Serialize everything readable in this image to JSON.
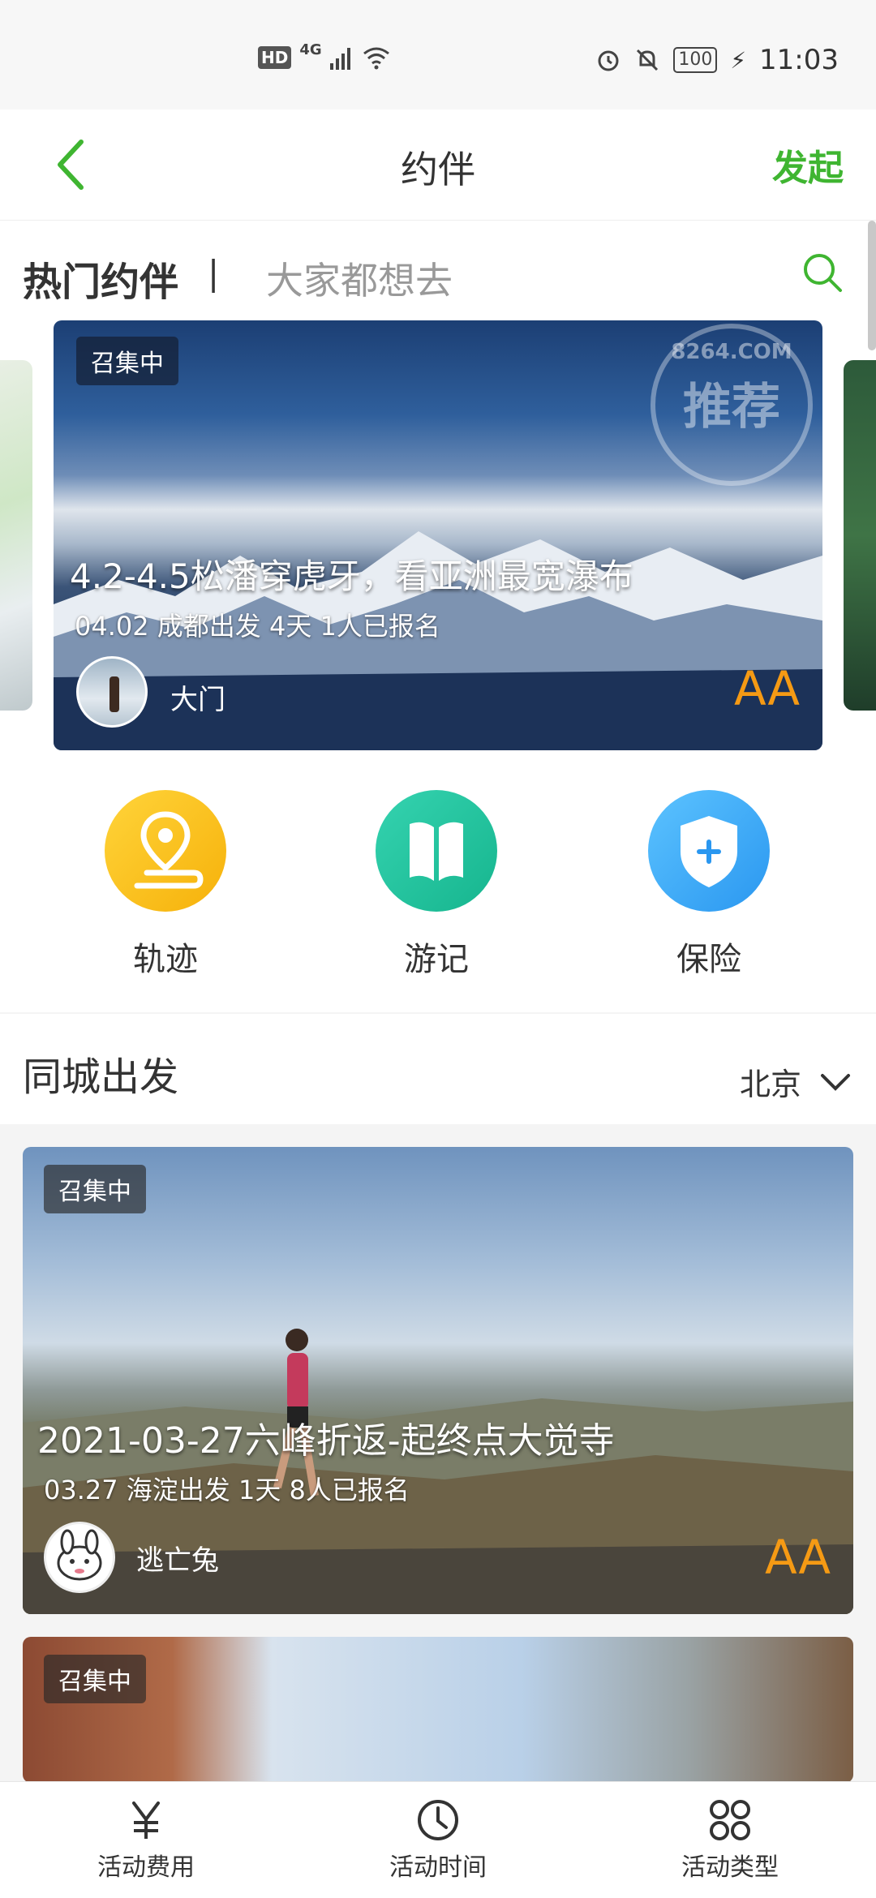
{
  "status_bar": {
    "hd": "HD",
    "network": "4G",
    "battery": "100",
    "time": "11:03"
  },
  "nav": {
    "title": "约伴",
    "action": "发起"
  },
  "hot": {
    "title": "热门约伴",
    "separator": "|",
    "subtitle": "大家都想去",
    "card": {
      "badge": "召集中",
      "stamp_site": "8264.COM",
      "stamp_text": "推荐",
      "title": "4.2-4.5松潘穿虎牙，看亚洲最宽瀑布",
      "meta": "04.02 成都出发 4天   1人已报名",
      "username": "大门",
      "cost": "AA"
    }
  },
  "quick_actions": [
    {
      "label": "轨迹",
      "icon": "location-track-icon",
      "color": "#f6b10a"
    },
    {
      "label": "游记",
      "icon": "book-icon",
      "color": "#16b58e"
    },
    {
      "label": "保险",
      "icon": "shield-plus-icon",
      "color": "#2a97f0"
    }
  ],
  "local": {
    "title": "同城出发",
    "city": "北京"
  },
  "events": [
    {
      "badge": "召集中",
      "title": "2021-03-27六峰折返-起终点大觉寺",
      "meta": "03.27 海淀出发 1天   8人已报名",
      "username": "逃亡兔",
      "cost": "AA"
    },
    {
      "badge": "召集中"
    }
  ],
  "bottom_tabs": [
    {
      "label": "活动费用",
      "icon": "yuan-icon"
    },
    {
      "label": "活动时间",
      "icon": "clock-icon"
    },
    {
      "label": "活动类型",
      "icon": "grid-circles-icon"
    }
  ],
  "colors": {
    "accent_green": "#3fb531",
    "cost_orange": "#f59a14"
  }
}
